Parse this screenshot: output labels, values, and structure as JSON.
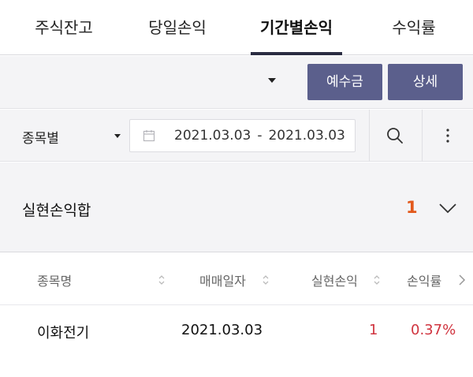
{
  "tabs": [
    {
      "label": "주식잔고",
      "active": false
    },
    {
      "label": "당일손익",
      "active": false
    },
    {
      "label": "기간별손익",
      "active": true
    },
    {
      "label": "수익률",
      "active": false
    }
  ],
  "actions": {
    "deposit_label": "예수금",
    "detail_label": "상세"
  },
  "filter": {
    "type_label": "종목별",
    "date_from": "2021.03.03",
    "date_separator": "-",
    "date_to": "2021.03.03"
  },
  "summary": {
    "title": "실현손익합",
    "value": "1"
  },
  "table": {
    "headers": [
      "종목명",
      "매매일자",
      "실현손익",
      "손익률"
    ],
    "rows": [
      {
        "name": "이화전기",
        "date": "2021.03.03",
        "pnl": "1",
        "rate": "0.37%"
      }
    ]
  },
  "colors": {
    "accent": "#2b2d42",
    "button": "#5b5f8c",
    "summary_value": "#e2591c",
    "profit_red": "#d0343f"
  }
}
